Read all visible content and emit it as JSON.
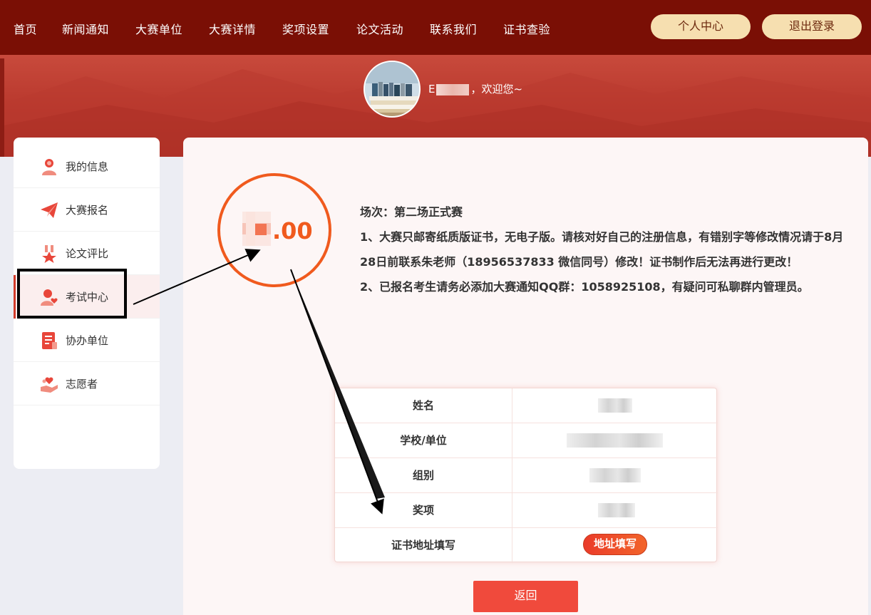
{
  "nav": {
    "items": [
      "首页",
      "新闻通知",
      "大赛单位",
      "大赛详情",
      "奖项设置",
      "论文活动",
      "联系我们",
      "证书查验"
    ],
    "personal_center": "个人中心",
    "logout": "退出登录"
  },
  "banner": {
    "welcome_text": "，欢迎您~",
    "name_prefix": "E"
  },
  "sidebar": {
    "items": [
      {
        "label": "我的信息",
        "icon": "user-icon"
      },
      {
        "label": "大赛报名",
        "icon": "paper-plane-icon"
      },
      {
        "label": "论文评比",
        "icon": "medal-icon"
      },
      {
        "label": "考试中心",
        "icon": "user-heart-icon"
      },
      {
        "label": "协办单位",
        "icon": "document-icon"
      },
      {
        "label": "志愿者",
        "icon": "hand-heart-icon"
      }
    ],
    "active_index": 3
  },
  "score": {
    "display": ".00",
    "color": "#f05a1e"
  },
  "info": {
    "session": "场次：第二场正式赛",
    "note1": "1、大赛只邮寄纸质版证书，无电子版。请核对好自己的注册信息，有错别字等修改情况请于8月28日前联系朱老师（18956537833 微信同号）修改！证书制作后无法再进行更改！",
    "note2": "2、已报名考生请务必添加大赛通知QQ群：1058925108，有疑问可私聊群内管理员。"
  },
  "table": {
    "rows": [
      {
        "label": "姓名"
      },
      {
        "label": "学校/单位"
      },
      {
        "label": "组别"
      },
      {
        "label": "奖项"
      },
      {
        "label": "证书地址填写"
      }
    ],
    "address_button": "地址填写"
  },
  "back_button": "返回",
  "colors": {
    "nav_bg": "#7a0f05",
    "accent": "#d23b2a",
    "pill_bg": "#f6dfb0",
    "button_red": "#f04a3c"
  }
}
